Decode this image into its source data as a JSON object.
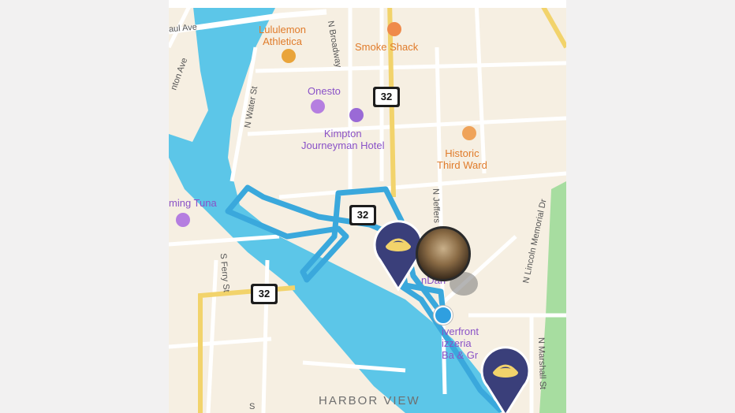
{
  "map": {
    "pois": {
      "lululemon": [
        "Lululemon",
        "Athletica"
      ],
      "smoke_shack": "Smoke Shack",
      "onesto": "Onesto",
      "kimpton": [
        "Kimpton",
        "Journeyman Hotel"
      ],
      "historic": [
        "Historic",
        "Third Ward"
      ],
      "flaming_tuna": "ming Tuna",
      "dan": "nDan",
      "riverfront": [
        "iverfront",
        "izzeria",
        "Ba  & Gr"
      ]
    },
    "streets": {
      "st_paul": "aul Ave",
      "clinton": "nton Ave",
      "broadway": "N Broadway",
      "water": "N Water St",
      "jefferson": "N Jeffers",
      "ferry": "S Ferry St",
      "lincoln": "N Lincoln Memorial Dr",
      "marshall": "N Marshall St",
      "s_bottom": "S"
    },
    "district": "HARBOR VIEW",
    "highway_number": "32",
    "colors": {
      "land": "#f6efe2",
      "water": "#5cc6e8",
      "route": "#3aa8dc",
      "park": "#a7dda0",
      "highway": "#f2d36b",
      "poi_purple": "#8a52c7",
      "poi_orange": "#e07b2a",
      "pin": "#3a3f7a"
    },
    "icons": {
      "pin": "food-bowl-pin",
      "avatar": "dog-avatar",
      "location": "current-location-dot"
    }
  }
}
